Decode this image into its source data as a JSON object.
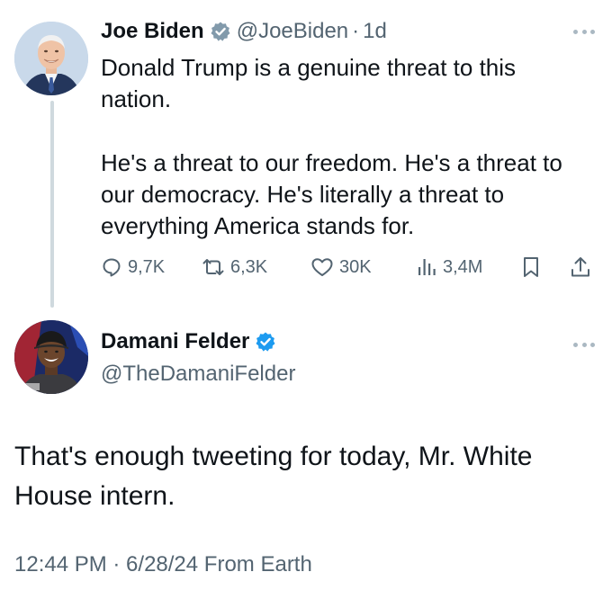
{
  "tweet1": {
    "author_name": "Joe Biden",
    "handle": "@JoeBiden",
    "separator": "·",
    "time": "1d",
    "text_paragraphs": [
      "Donald Trump is a genuine threat to this nation.",
      "He's a threat to our freedom. He's a threat to our democracy. He's literally a threat to everything America stands for."
    ],
    "actions": {
      "replies": "9,7K",
      "reposts": "6,3K",
      "likes": "30K",
      "views": "3,4M"
    },
    "verified_color": "#829aab"
  },
  "tweet2": {
    "author_name": "Damani Felder",
    "handle": "@TheDamaniFelder",
    "text": "That's enough tweeting for today, Mr. White House intern.",
    "timestamp": "12:44 PM · 6/28/24 From Earth",
    "verified_color": "#1d9bf0"
  },
  "colors": {
    "text_primary": "#0f1419",
    "text_secondary": "#536471",
    "thread_line": "#cfd9de"
  },
  "icons": {
    "reply": "reply-icon",
    "repost": "repost-icon",
    "like": "heart-icon",
    "views": "views-chart-icon",
    "bookmark": "bookmark-icon",
    "share": "share-icon",
    "more": "more-dots-icon"
  }
}
